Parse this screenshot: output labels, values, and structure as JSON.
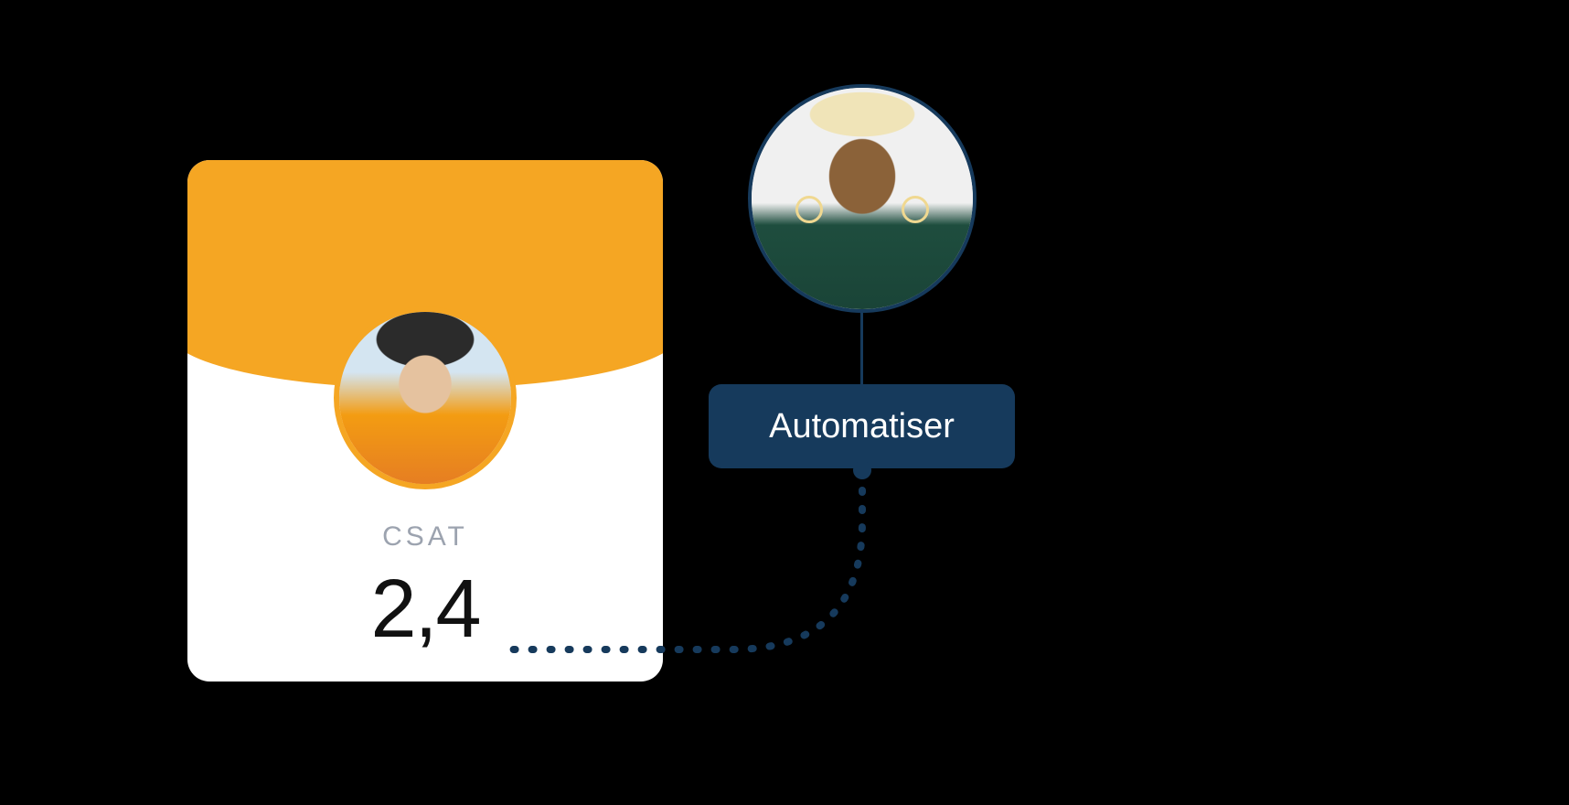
{
  "csat_card": {
    "label": "CSAT",
    "value": "2,4",
    "avatar_name": "customer-avatar"
  },
  "agent": {
    "avatar_name": "agent-avatar"
  },
  "button": {
    "label": "Automatiser"
  },
  "colors": {
    "accent_yellow": "#f5a623",
    "brand_navy": "#163a5c",
    "text_muted": "#9ca3af",
    "text_dark": "#111111"
  }
}
